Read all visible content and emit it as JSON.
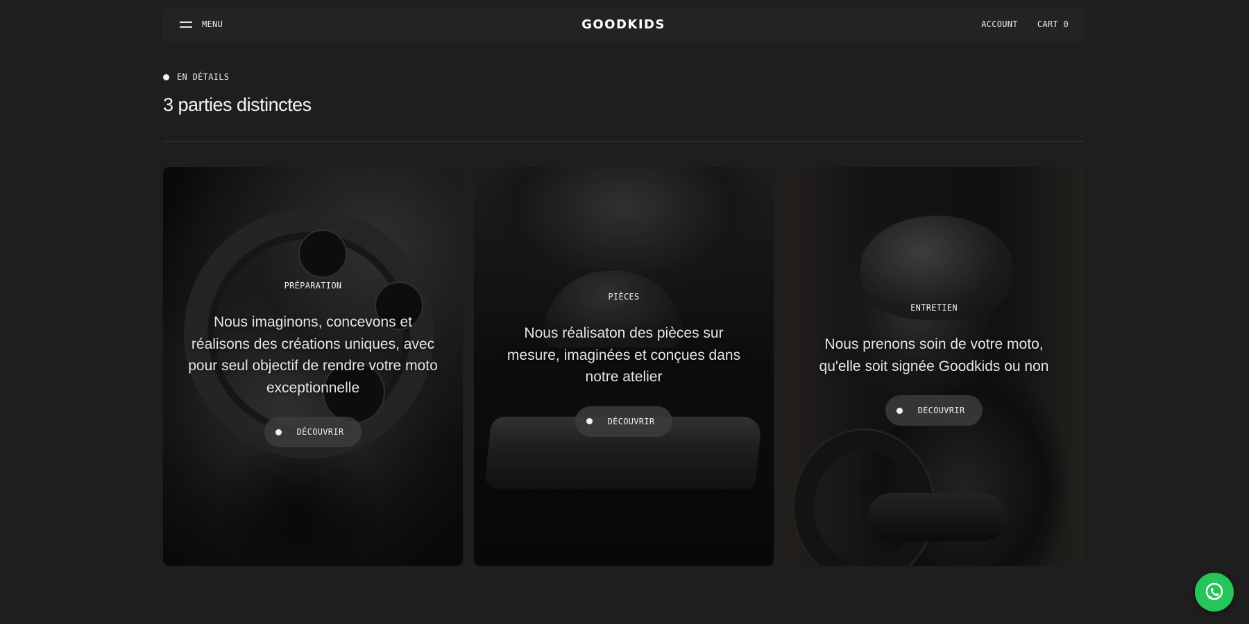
{
  "header": {
    "menu_label": "MENU",
    "logo": "GOODKIDS",
    "account_label": "ACCOUNT",
    "cart_label": "CART 0"
  },
  "section": {
    "eyebrow": "EN DÉTAILS",
    "title": "3 parties distinctes"
  },
  "cards": [
    {
      "label": "PRÉPARATION",
      "text": "Nous imaginons, concevons et réalisons des créations uniques, avec pour seul objectif de rendre votre moto exceptionnelle",
      "button": "DÉCOUVRIR"
    },
    {
      "label": "PIÈCES",
      "text": "Nous réalisaton des pièces sur mesure, imaginées et conçues dans notre atelier",
      "button": "DÉCOUVRIR"
    },
    {
      "label": "ENTRETIEN",
      "text": "Nous prenons soin de votre moto, qu'elle soit signée Goodkids ou non",
      "button": "DÉCOUVRIR"
    }
  ],
  "colors": {
    "background": "#1e1e1e",
    "header_bg": "#232323",
    "whatsapp": "#25c55c"
  },
  "icons": {
    "menu": "hamburger-icon",
    "whatsapp": "whatsapp-icon",
    "bullet": "dot-icon"
  }
}
